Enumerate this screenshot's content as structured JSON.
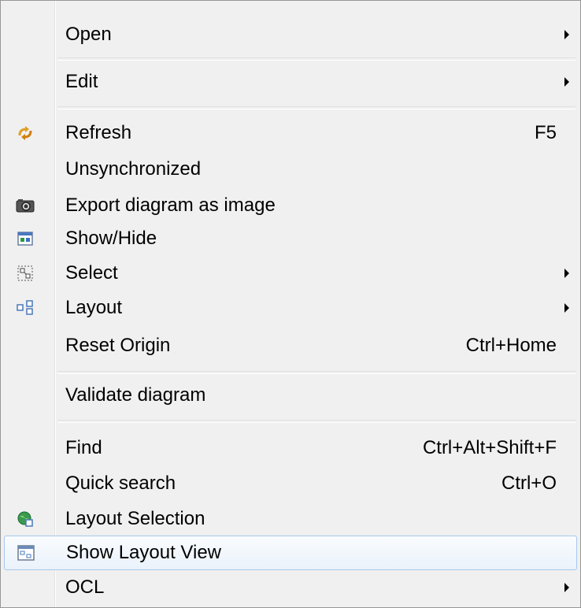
{
  "menu": {
    "open": "Open",
    "edit": "Edit",
    "refresh": "Refresh",
    "refresh_shortcut": "F5",
    "unsynchronized": "Unsynchronized",
    "export": "Export diagram as image",
    "showhide": "Show/Hide",
    "select": "Select",
    "layout": "Layout",
    "reset_origin": "Reset Origin",
    "reset_origin_shortcut": "Ctrl+Home",
    "validate": "Validate diagram",
    "find": "Find",
    "find_shortcut": "Ctrl+Alt+Shift+F",
    "quick_search": "Quick search",
    "quick_search_shortcut": "Ctrl+O",
    "layout_selection": "Layout Selection",
    "show_layout_view": "Show Layout View",
    "ocl": "OCL"
  },
  "icons": {
    "refresh": "refresh-icon",
    "export": "camera-icon",
    "showhide": "show-hide-icon",
    "select": "select-icon",
    "layout": "layout-icon",
    "layout_selection": "globe-layout-icon",
    "show_layout_view": "layout-view-icon"
  },
  "colors": {
    "menu_bg": "#f0f0f0",
    "highlight_border": "#a8c8ee",
    "highlight_bg": "#eaf2fb"
  }
}
